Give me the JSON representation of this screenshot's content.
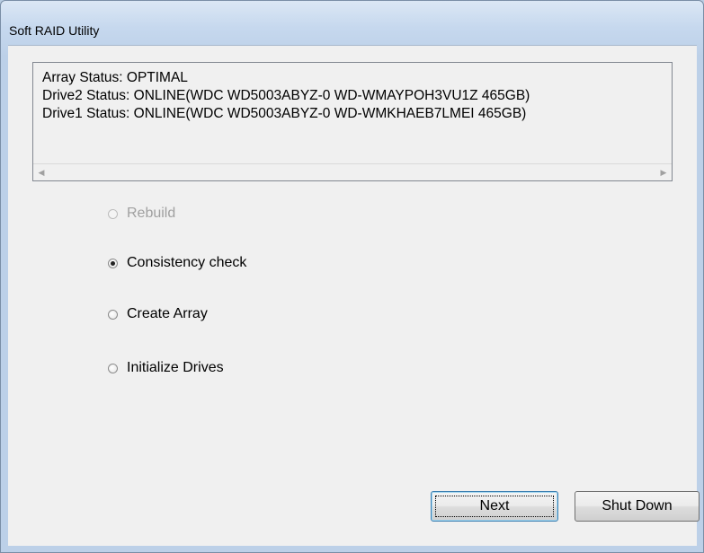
{
  "window": {
    "title": "Soft RAID Utility"
  },
  "status": {
    "lines": [
      "Array Status: OPTIMAL",
      "Drive2 Status: ONLINE(WDC WD5003ABYZ-0 WD-WMAYPOH3VU1Z 465GB)",
      "Drive1 Status: ONLINE(WDC WD5003ABYZ-0 WD-WMKHAEB7LMEI 465GB)"
    ],
    "scroll_left_icon": "◀",
    "scroll_right_icon": "▶"
  },
  "options": [
    {
      "label": "Rebuild",
      "checked": false,
      "enabled": false
    },
    {
      "label": "Consistency check",
      "checked": true,
      "enabled": true
    },
    {
      "label": "Create Array",
      "checked": false,
      "enabled": true
    },
    {
      "label": "Initialize Drives",
      "checked": false,
      "enabled": true
    }
  ],
  "buttons": {
    "next": "Next",
    "shutdown": "Shut Down"
  }
}
